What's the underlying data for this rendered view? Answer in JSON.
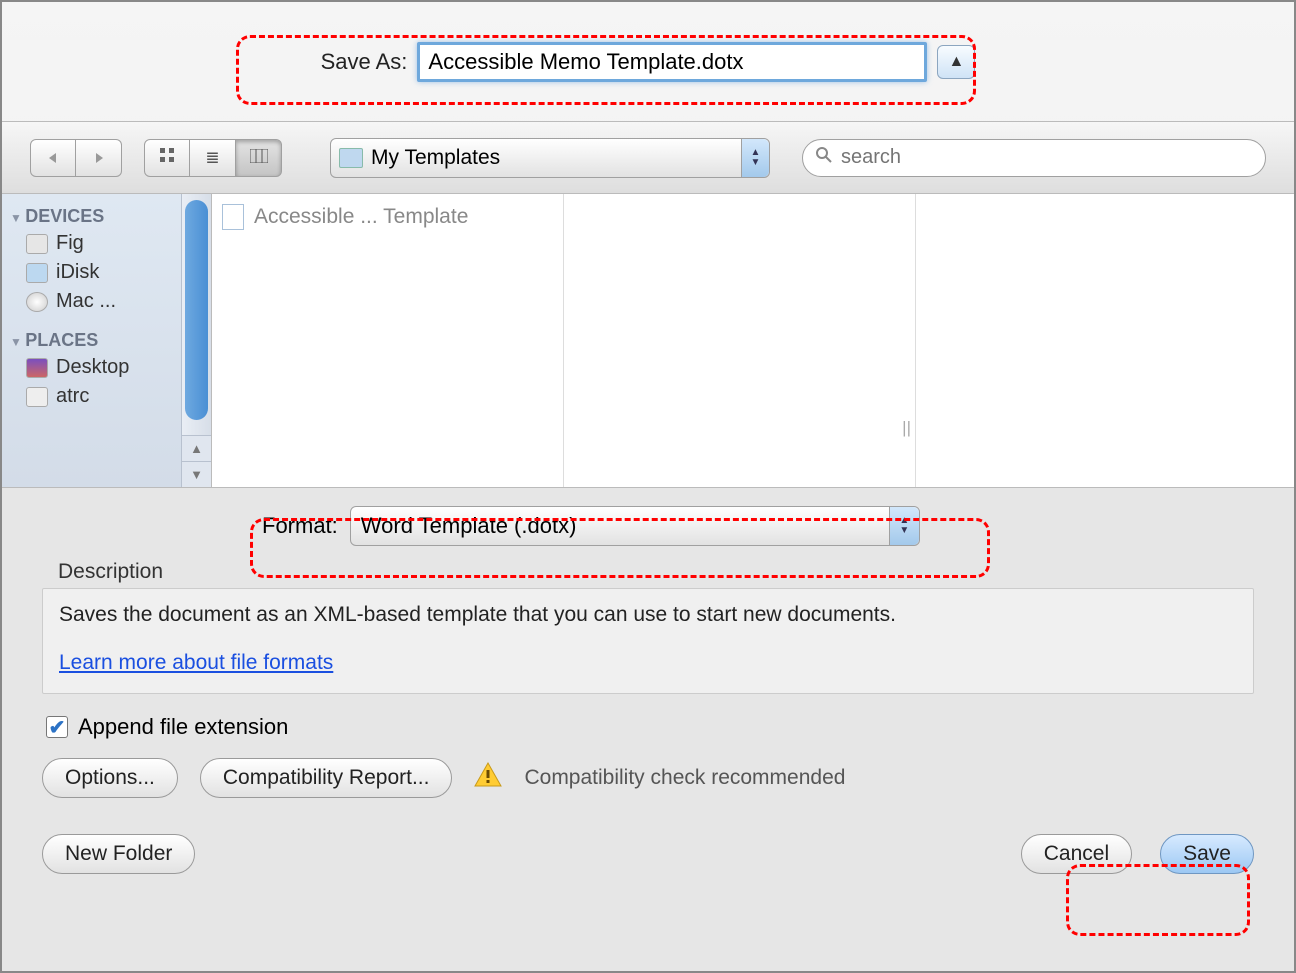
{
  "saveAs": {
    "label": "Save As:",
    "value": "Accessible Memo Template.dotx"
  },
  "toolbar": {
    "folder": "My Templates",
    "search_placeholder": "search"
  },
  "sidebar": {
    "devices_header": "DEVICES",
    "devices": [
      "Fig",
      "iDisk",
      "Mac ..."
    ],
    "places_header": "PLACES",
    "places": [
      "Desktop",
      "atrc"
    ]
  },
  "filelist": {
    "file1": "Accessible ... Template"
  },
  "format": {
    "label": "Format:",
    "value": "Word Template (.dotx)"
  },
  "description": {
    "label": "Description",
    "text": "Saves the document as an XML-based template that you can use to start new documents.",
    "link": "Learn more about file formats"
  },
  "append": {
    "label": "Append file extension",
    "checked": true
  },
  "buttons": {
    "options": "Options...",
    "compat_report": "Compatibility Report...",
    "compat_text": "Compatibility check recommended",
    "new_folder": "New Folder",
    "cancel": "Cancel",
    "save": "Save"
  }
}
